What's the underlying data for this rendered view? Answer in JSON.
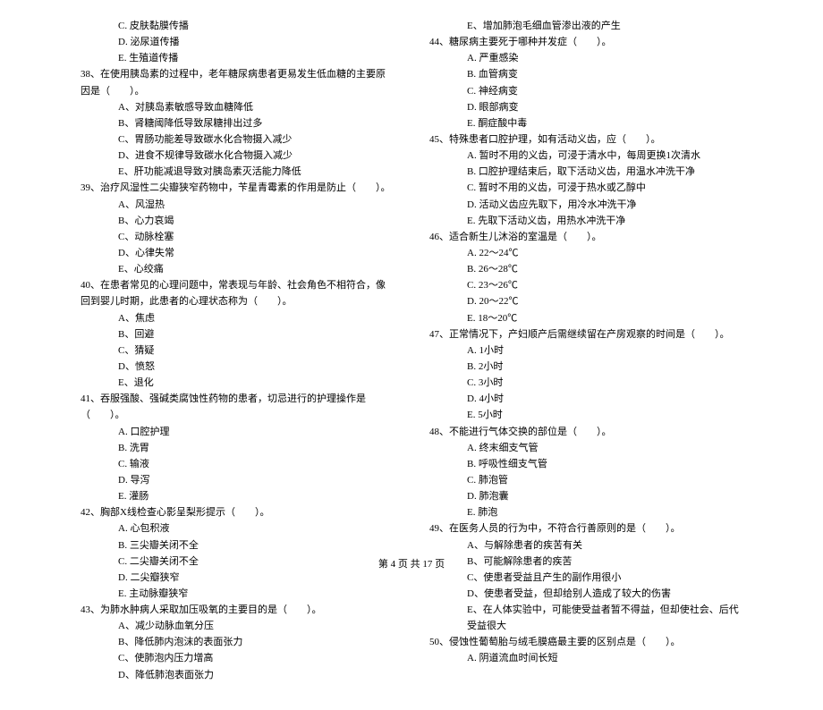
{
  "left": {
    "pre_options": [
      "C. 皮肤黏膜传播",
      "D. 泌尿道传播",
      "E. 生殖道传播"
    ],
    "q38": {
      "stem": "38、在使用胰岛素的过程中，老年糖尿病患者更易发生低血糖的主要原因是（　　）。",
      "opts": [
        "A、对胰岛素敏感导致血糖降低",
        "B、肾糖阈降低导致尿糖排出过多",
        "C、胃肠功能差导致碳水化合物摄入减少",
        "D、进食不规律导致碳水化合物摄入减少",
        "E、肝功能减退导致对胰岛素灭活能力降低"
      ]
    },
    "q39": {
      "stem": "39、治疗风湿性二尖瓣狭窄药物中，苄星青霉素的作用是防止（　　）。",
      "opts": [
        "A、风湿热",
        "B、心力哀竭",
        "C、动脉栓塞",
        "D、心律失常",
        "E、心绞痛"
      ]
    },
    "q40": {
      "stem": "40、在患者常见的心理问题中，常表现与年龄、社会角色不相符合，像回到婴儿时期，此患者的心理状态称为（　　）。",
      "opts": [
        "A、焦虑",
        "B、回避",
        "C、猜疑",
        "D、愤怒",
        "E、退化"
      ]
    },
    "q41": {
      "stem": "41、吞服强酸、强碱类腐蚀性药物的患者，切忌进行的护理操作是（　　）。",
      "opts": [
        "A. 口腔护理",
        "B. 洗胃",
        "C. 输液",
        "D. 导泻",
        "E. 灌肠"
      ]
    },
    "q42": {
      "stem": "42、胸部X线检查心影呈梨形提示（　　）。",
      "opts": [
        "A. 心包积液",
        "B. 三尖瓣关闭不全",
        "C. 二尖瓣关闭不全",
        "D. 二尖瓣狭窄",
        "E. 主动脉瓣狭窄"
      ]
    },
    "q43": {
      "stem": "43、为肺水肿病人采取加压吸氧的主要目的是（　　）。",
      "opts": [
        "A、减少动脉血氧分压",
        "B、降低肺内泡沫的表面张力",
        "C、使肺泡内压力增高",
        "D、降低肺泡表面张力"
      ]
    }
  },
  "right": {
    "pre_options": [
      "E、增加肺泡毛细血管渗出液的产生"
    ],
    "q44": {
      "stem": "44、糖尿病主要死于哪种并发症（　　）。",
      "opts": [
        "A. 严重感染",
        "B. 血管病变",
        "C. 神经病变",
        "D. 眼部病变",
        "E. 酮症酸中毒"
      ]
    },
    "q45": {
      "stem": "45、特殊患者口腔护理，如有活动义齿，应（　　）。",
      "opts": [
        "A. 暂时不用的义齿，可浸于清水中，每周更换1次清水",
        "B. 口腔护理结束后，取下活动义齿，用温水冲洗干净",
        "C. 暂时不用的义齿，可浸于热水或乙醇中",
        "D. 活动义齿应先取下，用冷水冲洗干净",
        "E. 先取下活动义齿，用热水冲洗干净"
      ]
    },
    "q46": {
      "stem": "46、适合新生儿沐浴的室温是（　　）。",
      "opts": [
        "A. 22～24℃",
        "B. 26～28℃",
        "C. 23～26℃",
        "D. 20～22℃",
        "E. 18～20℃"
      ]
    },
    "q47": {
      "stem": "47、正常情况下，产妇顺产后需继续留在产房观察的时间是（　　）。",
      "opts": [
        "A. 1小时",
        "B. 2小时",
        "C. 3小时",
        "D. 4小时",
        "E. 5小时"
      ]
    },
    "q48": {
      "stem": "48、不能进行气体交换的部位是（　　）。",
      "opts": [
        "A. 终末细支气管",
        "B. 呼吸性细支气管",
        "C. 肺泡管",
        "D. 肺泡囊",
        "E. 肺泡"
      ]
    },
    "q49": {
      "stem": "49、在医务人员的行为中，不符合行善原则的是（　　）。",
      "opts": [
        "A、与解除患者的疾苦有关",
        "B、可能解除患者的疾苦",
        "C、使患者受益且产生的副作用很小",
        "D、使患者受益，但却给别人造成了较大的伤害",
        "E、在人体实验中，可能使受益者暂不得益，但却使社会、后代受益很大"
      ]
    },
    "q50": {
      "stem": "50、侵蚀性葡萄胎与绒毛膜癌最主要的区别点是（　　）。",
      "opts": [
        "A. 阴道流血时间长短"
      ]
    }
  },
  "footer": "第 4 页 共 17 页"
}
